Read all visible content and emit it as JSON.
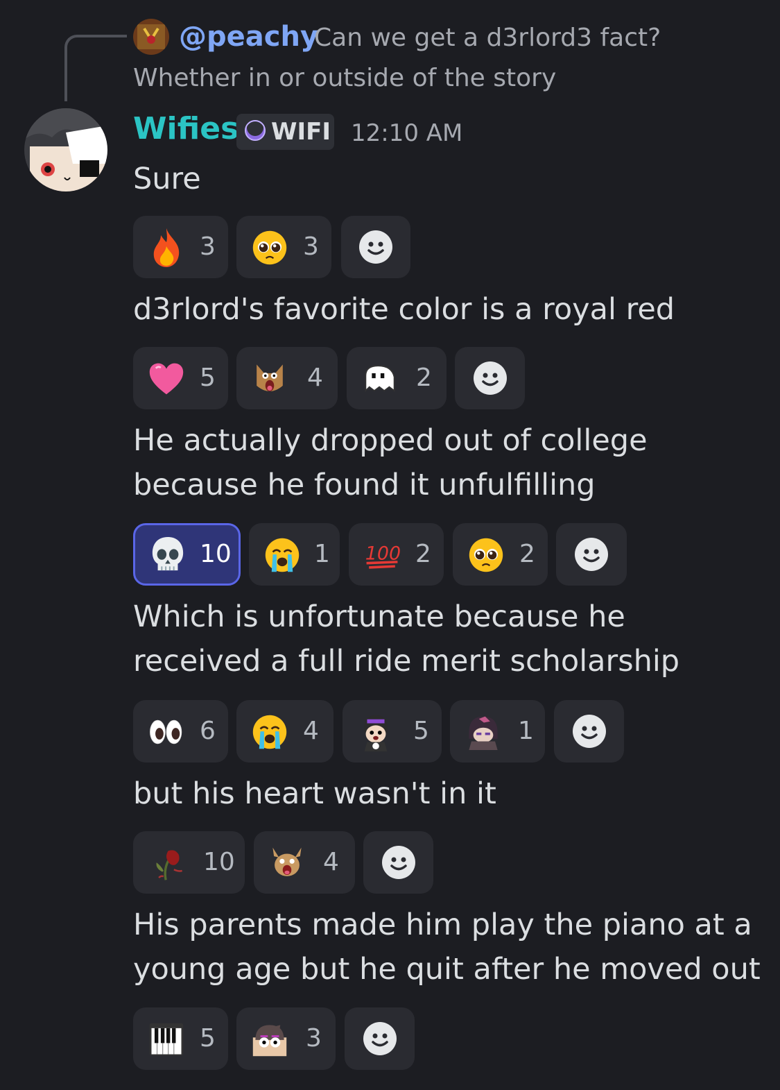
{
  "reply": {
    "author": "@peachy",
    "text_line1": "Can we get a d3rlord3 fact?",
    "text_line2": "Whether in or outside of the story"
  },
  "message": {
    "author": "Wifies",
    "tag": "WIFI",
    "timestamp": "12:10 AM",
    "author_color": "#2bc4c4"
  },
  "messages": [
    {
      "lines": [
        "Sure"
      ]
    },
    {
      "lines": [
        "d3rlord's favorite color is a royal red"
      ]
    },
    {
      "lines": [
        "He actually dropped out of college",
        "because he found it unfulfilling"
      ]
    },
    {
      "lines": [
        "Which is unfortunate because he",
        "received a full ride merit scholarship"
      ]
    },
    {
      "lines": [
        "but his heart wasn't in it"
      ]
    },
    {
      "lines": [
        "His parents made him play the piano at a",
        "young age but he quit after he moved out"
      ]
    }
  ],
  "reactions": [
    [
      {
        "icon": "fire-emoji",
        "count": "3"
      },
      {
        "icon": "pleading-face-emoji",
        "count": "3"
      }
    ],
    [
      {
        "icon": "pink-heart-emoji",
        "count": "5"
      },
      {
        "icon": "screaming-cat-custom-emoji",
        "count": "4"
      },
      {
        "icon": "ghost-custom-emoji",
        "count": "2"
      }
    ],
    [
      {
        "icon": "skull-emoji",
        "count": "10",
        "active": true
      },
      {
        "icon": "crying-face-emoji",
        "count": "1"
      },
      {
        "icon": "hundred-points-emoji",
        "count": "2"
      },
      {
        "icon": "pleading-face-emoji",
        "count": "2"
      }
    ],
    [
      {
        "icon": "eyes-emoji",
        "count": "6"
      },
      {
        "icon": "crying-face-emoji",
        "count": "4"
      },
      {
        "icon": "character-custom-emoji",
        "count": "5"
      },
      {
        "icon": "character-custom-emoji-2",
        "count": "1"
      }
    ],
    [
      {
        "icon": "wilted-rose-emoji",
        "count": "10"
      },
      {
        "icon": "scared-custom-emoji",
        "count": "4"
      }
    ],
    [
      {
        "icon": "piano-keys-emoji",
        "count": "5"
      },
      {
        "icon": "peeking-custom-emoji",
        "count": "3"
      }
    ]
  ],
  "colors": {
    "background": "#1c1d22",
    "reaction_bg": "#2a2b31",
    "reaction_active_bg": "#2f3578",
    "reaction_active_border": "#5a66e8",
    "reply_author": "#7fa6f5"
  }
}
